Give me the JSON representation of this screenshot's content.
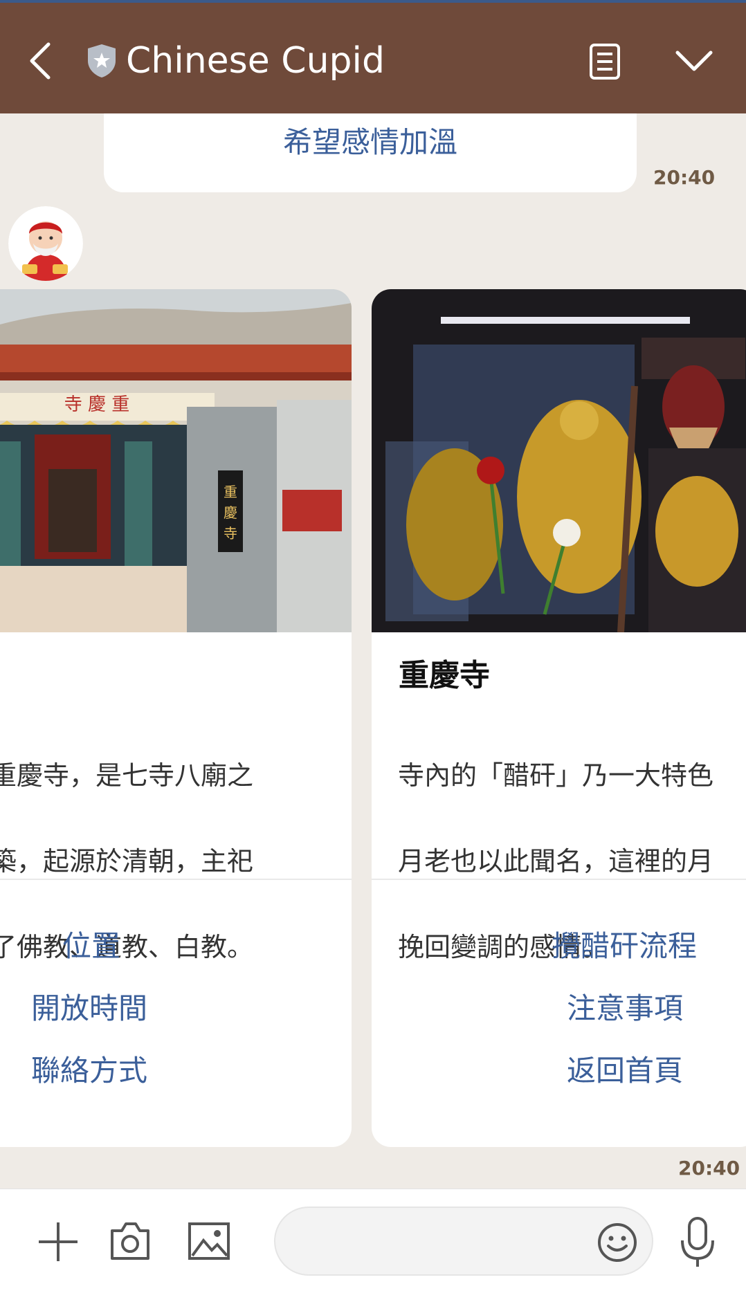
{
  "header": {
    "title": "Chinese Cupid",
    "back_icon": "back-arrow-icon",
    "shield_icon": "verified-shield-icon",
    "notes_icon": "notes-icon",
    "dropdown_icon": "chevron-down-icon"
  },
  "messages": {
    "top_bubble_text": "希望感情加溫",
    "top_time": "20:40",
    "carousel_time": "20:40"
  },
  "cards": [
    {
      "title": "",
      "desc_lines": [
        "是重慶寺，是七寺八廟之",
        "建築，起源於清朝，主祀",
        "合了佛教、道教、白教。"
      ],
      "sign_text": "重慶寺",
      "actions": [
        "位置",
        "開放時間",
        "聯絡方式"
      ]
    },
    {
      "title": "重慶寺",
      "desc_lines": [
        "寺內的「醋矸」乃一大特色",
        "月老也以此聞名，這裡的月",
        "挽回變調的感情。"
      ],
      "actions": [
        "攪醋矸流程",
        "注意事項",
        "返回首頁"
      ]
    }
  ],
  "input": {
    "placeholder": "",
    "plus_icon": "plus-icon",
    "camera_icon": "camera-icon",
    "image_icon": "image-icon",
    "emoji_icon": "emoji-icon",
    "mic_icon": "microphone-icon"
  },
  "colors": {
    "header_bg": "#6f4a3a",
    "chat_bg": "#efebe6",
    "link_blue": "#3b5f9a"
  }
}
